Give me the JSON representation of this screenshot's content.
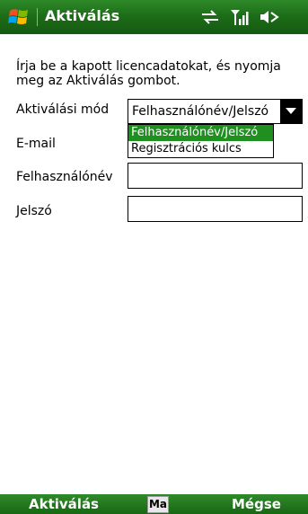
{
  "titlebar": {
    "title": "Aktiválás",
    "start_icon": "windows-flag-icon",
    "status_icons": [
      "connectivity-arrows-icon",
      "signal-strength-icon",
      "speaker-icon"
    ]
  },
  "form": {
    "instruction": "Írja be a kapott licencadatokat, és nyomja meg az Aktiválás gombot.",
    "mode_label": "Aktiválási mód",
    "mode_value": "Felhasználónév/Jelszó",
    "mode_options": [
      "Felhasználónév/Jelszó",
      "Regisztrációs kulcs"
    ],
    "email_label": "E-mail",
    "email_value": "",
    "username_label": "Felhasználónév",
    "username_value": "",
    "password_label": "Jelszó",
    "password_value": ""
  },
  "softkeys": {
    "left": "Aktiválás",
    "input_mode": "Ma",
    "right": "Mégse"
  },
  "colors": {
    "bar_green": "#1d6d18",
    "selection_green": "#1f8f1f",
    "text": "#000000",
    "background": "#ffffff"
  }
}
